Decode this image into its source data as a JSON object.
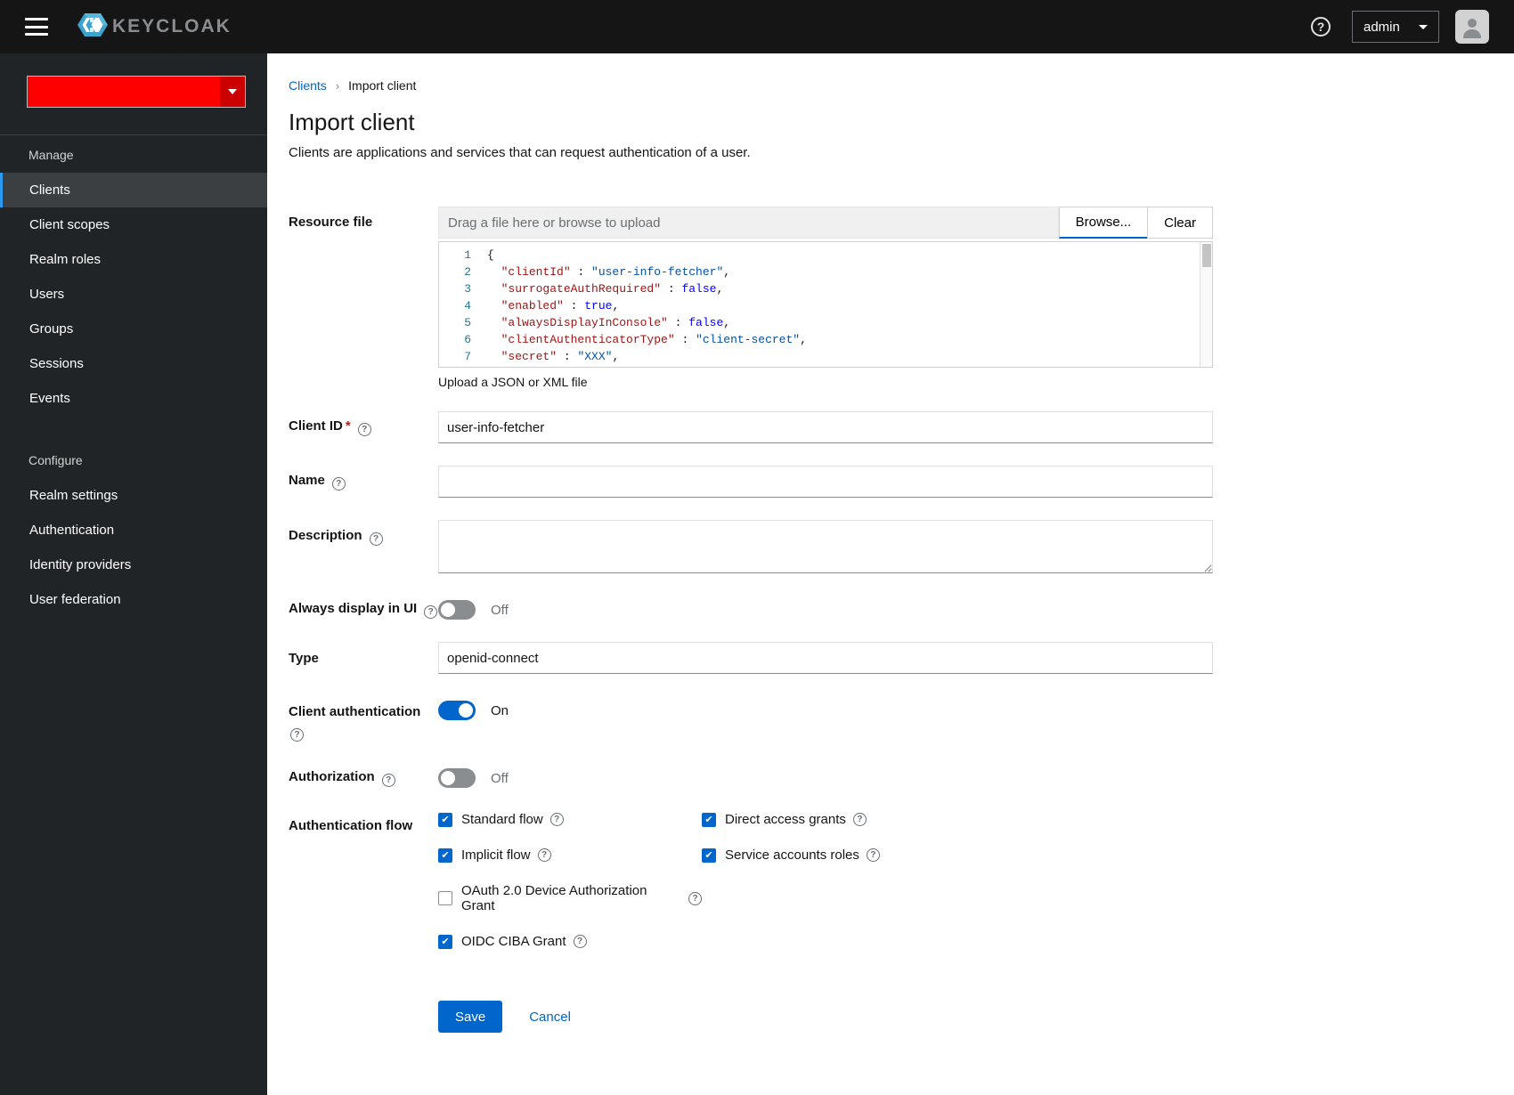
{
  "topbar": {
    "brand": "KEYCLOAK",
    "user": "admin"
  },
  "sidebar": {
    "sections": [
      {
        "title": "Manage",
        "items": [
          {
            "label": "Clients",
            "active": true
          },
          {
            "label": "Client scopes",
            "active": false
          },
          {
            "label": "Realm roles",
            "active": false
          },
          {
            "label": "Users",
            "active": false
          },
          {
            "label": "Groups",
            "active": false
          },
          {
            "label": "Sessions",
            "active": false
          },
          {
            "label": "Events",
            "active": false
          }
        ]
      },
      {
        "title": "Configure",
        "items": [
          {
            "label": "Realm settings",
            "active": false
          },
          {
            "label": "Authentication",
            "active": false
          },
          {
            "label": "Identity providers",
            "active": false
          },
          {
            "label": "User federation",
            "active": false
          }
        ]
      }
    ]
  },
  "breadcrumb": {
    "parent": "Clients",
    "current": "Import client"
  },
  "page": {
    "title": "Import client",
    "subtitle": "Clients are applications and services that can request authentication of a user."
  },
  "form": {
    "resource_file": {
      "label": "Resource file",
      "placeholder": "Drag a file here or browse to upload",
      "browse_label": "Browse...",
      "clear_label": "Clear",
      "helper": "Upload a JSON or XML file"
    },
    "editor": {
      "lines": [
        [
          {
            "t": "plain",
            "s": "{"
          }
        ],
        [
          {
            "t": "plain",
            "s": "  "
          },
          {
            "t": "key",
            "s": "\"clientId\""
          },
          {
            "t": "plain",
            "s": " : "
          },
          {
            "t": "str",
            "s": "\"user-info-fetcher\""
          },
          {
            "t": "plain",
            "s": ","
          }
        ],
        [
          {
            "t": "plain",
            "s": "  "
          },
          {
            "t": "key",
            "s": "\"surrogateAuthRequired\""
          },
          {
            "t": "plain",
            "s": " : "
          },
          {
            "t": "bool",
            "s": "false"
          },
          {
            "t": "plain",
            "s": ","
          }
        ],
        [
          {
            "t": "plain",
            "s": "  "
          },
          {
            "t": "key",
            "s": "\"enabled\""
          },
          {
            "t": "plain",
            "s": " : "
          },
          {
            "t": "bool",
            "s": "true"
          },
          {
            "t": "plain",
            "s": ","
          }
        ],
        [
          {
            "t": "plain",
            "s": "  "
          },
          {
            "t": "key",
            "s": "\"alwaysDisplayInConsole\""
          },
          {
            "t": "plain",
            "s": " : "
          },
          {
            "t": "bool",
            "s": "false"
          },
          {
            "t": "plain",
            "s": ","
          }
        ],
        [
          {
            "t": "plain",
            "s": "  "
          },
          {
            "t": "key",
            "s": "\"clientAuthenticatorType\""
          },
          {
            "t": "plain",
            "s": " : "
          },
          {
            "t": "str",
            "s": "\"client-secret\""
          },
          {
            "t": "plain",
            "s": ","
          }
        ],
        [
          {
            "t": "plain",
            "s": "  "
          },
          {
            "t": "key",
            "s": "\"secret\""
          },
          {
            "t": "plain",
            "s": " : "
          },
          {
            "t": "str",
            "s": "\"XXX\""
          },
          {
            "t": "plain",
            "s": ","
          }
        ]
      ]
    },
    "client_id": {
      "label": "Client ID",
      "required": "*",
      "value": "user-info-fetcher"
    },
    "name": {
      "label": "Name",
      "value": ""
    },
    "description": {
      "label": "Description",
      "value": ""
    },
    "always_display": {
      "label": "Always display in UI",
      "state": "Off",
      "on": false
    },
    "type": {
      "label": "Type",
      "value": "openid-connect"
    },
    "client_authentication": {
      "label": "Client authentication",
      "state": "On",
      "on": true
    },
    "authorization": {
      "label": "Authorization",
      "state": "Off",
      "on": false
    },
    "auth_flow": {
      "label": "Authentication flow",
      "items": [
        {
          "label": "Standard flow",
          "checked": true
        },
        {
          "label": "Direct access grants",
          "checked": true
        },
        {
          "label": "Implicit flow",
          "checked": true
        },
        {
          "label": "Service accounts roles",
          "checked": true
        },
        {
          "label": "OAuth 2.0 Device Authorization Grant",
          "checked": false
        },
        {
          "label": "OIDC CIBA Grant",
          "checked": true
        }
      ]
    },
    "save_label": "Save",
    "cancel_label": "Cancel"
  },
  "colors": {
    "accent": "#0066cc",
    "topbar": "#151515",
    "sidebar": "#212427",
    "realm_red": "#ff0000"
  }
}
